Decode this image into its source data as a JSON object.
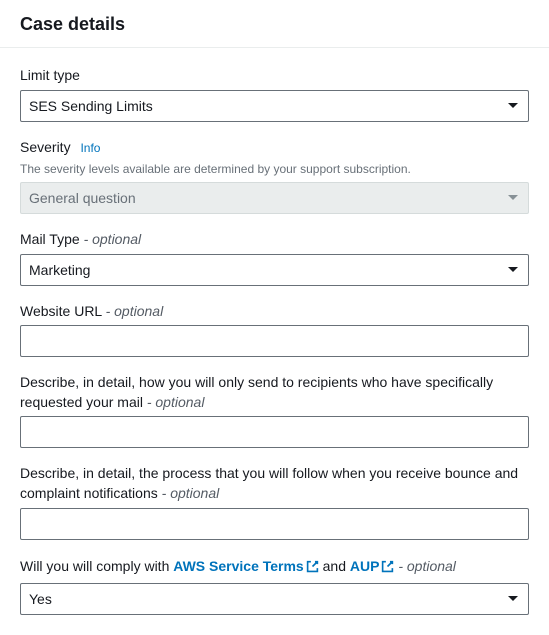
{
  "header": {
    "title": "Case details"
  },
  "limitType": {
    "label": "Limit type",
    "value": "SES Sending Limits"
  },
  "severity": {
    "label": "Severity",
    "infoLabel": "Info",
    "helpText": "The severity levels available are determined by your support subscription.",
    "value": "General question"
  },
  "mailType": {
    "label": "Mail Type",
    "optional": "- optional",
    "value": "Marketing"
  },
  "websiteUrl": {
    "label": "Website URL",
    "optional": "- optional",
    "value": ""
  },
  "describeRecipients": {
    "label": "Describe, in detail, how you will only send to recipients who have specifically requested your mail",
    "optional": "- optional",
    "value": ""
  },
  "describeBounce": {
    "label": "Describe, in detail, the process that you will follow when you receive bounce and complaint notifications",
    "optional": "- optional",
    "value": ""
  },
  "comply": {
    "labelPrefix": "Will you will comply with ",
    "link1": "AWS Service Terms",
    "labelMid": " and ",
    "link2": "AUP",
    "optional": " - optional",
    "value": "Yes"
  }
}
